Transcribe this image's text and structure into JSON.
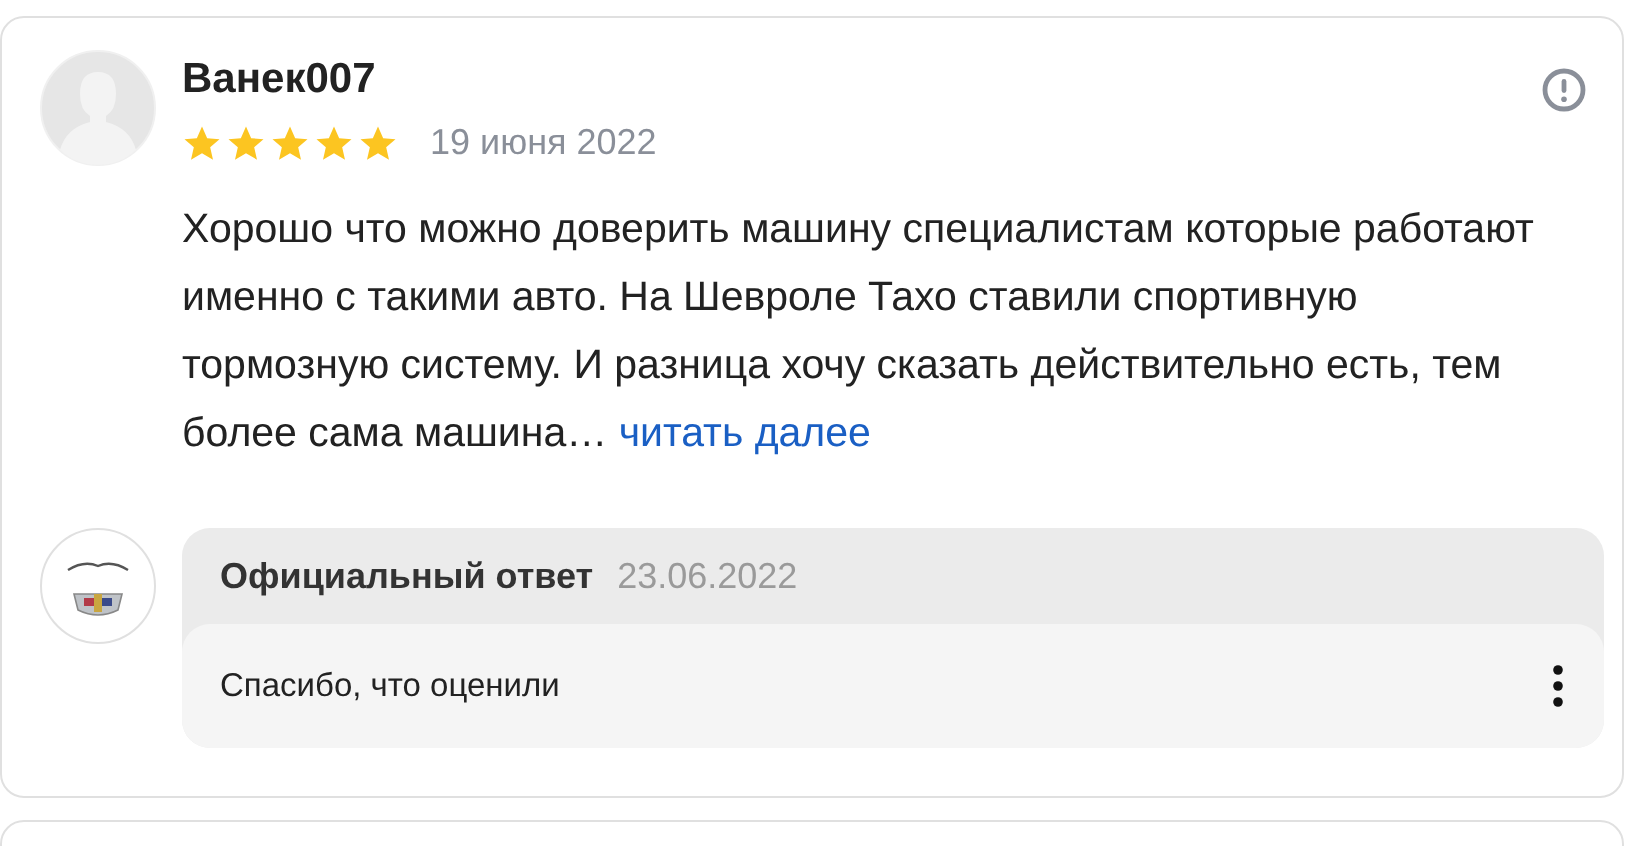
{
  "review": {
    "author": "Ванек007",
    "stars": 5,
    "date": "19 июня 2022",
    "text": "Хорошо что можно доверить машину специалистам которые работают именно с такими авто. На Шевроле Тахо ставили спортивную тормозную систему. И разница хочу сказать действительно есть, тем более сама машина…",
    "more_link": "читать далее"
  },
  "reply": {
    "title": "Официальный ответ",
    "date": "23.06.2022",
    "text": "Спасибо, что оценили"
  }
}
